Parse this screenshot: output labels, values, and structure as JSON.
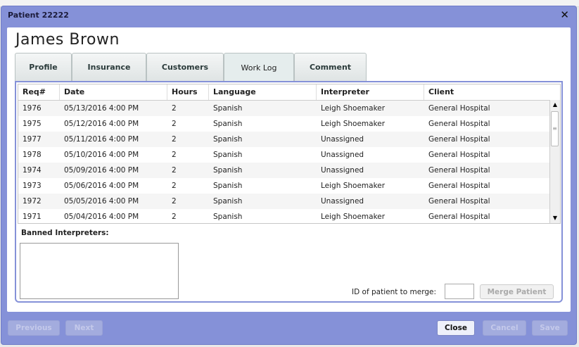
{
  "window": {
    "title": "Patient 22222",
    "close_glyph": "✕"
  },
  "patient": {
    "name": "James Brown"
  },
  "tabs": [
    {
      "label": "Profile",
      "active": false
    },
    {
      "label": "Insurance",
      "active": false
    },
    {
      "label": "Customers",
      "active": false
    },
    {
      "label": "Work Log",
      "active": true
    },
    {
      "label": "Comment",
      "active": false
    }
  ],
  "worklog": {
    "columns": [
      "Req#",
      "Date",
      "Hours",
      "Language",
      "Interpreter",
      "Client"
    ],
    "rows": [
      [
        "1976",
        "05/13/2016 4:00 PM",
        "2",
        "Spanish",
        " Leigh Shoemaker",
        "General Hospital"
      ],
      [
        "1975",
        "05/12/2016 4:00 PM",
        "2",
        "Spanish",
        " Leigh Shoemaker",
        "General Hospital"
      ],
      [
        "1977",
        "05/11/2016 4:00 PM",
        "2",
        "Spanish",
        "Unassigned",
        "General Hospital"
      ],
      [
        "1978",
        "05/10/2016 4:00 PM",
        "2",
        "Spanish",
        "Unassigned",
        "General Hospital"
      ],
      [
        "1974",
        "05/09/2016 4:00 PM",
        "2",
        "Spanish",
        "Unassigned",
        "General Hospital"
      ],
      [
        "1973",
        "05/06/2016 4:00 PM",
        "2",
        "Spanish",
        " Leigh Shoemaker",
        "General Hospital"
      ],
      [
        "1972",
        "05/05/2016 4:00 PM",
        "2",
        "Spanish",
        "Unassigned",
        "General Hospital"
      ],
      [
        "1971",
        "05/04/2016 4:00 PM",
        "2",
        "Spanish",
        " Leigh Shoemaker",
        "General Hospital"
      ]
    ]
  },
  "banned": {
    "label": "Banned Interpreters:"
  },
  "merge": {
    "label": "ID of patient to merge:",
    "value": "",
    "button": "Merge Patient"
  },
  "footer": {
    "previous": "Previous",
    "next": "Next",
    "close": "Close",
    "cancel": "Cancel",
    "save": "Save"
  },
  "icons": {
    "scroll_up": "scroll-up-arrow-icon",
    "scroll_down": "scroll-down-arrow-icon",
    "close": "close-icon"
  }
}
